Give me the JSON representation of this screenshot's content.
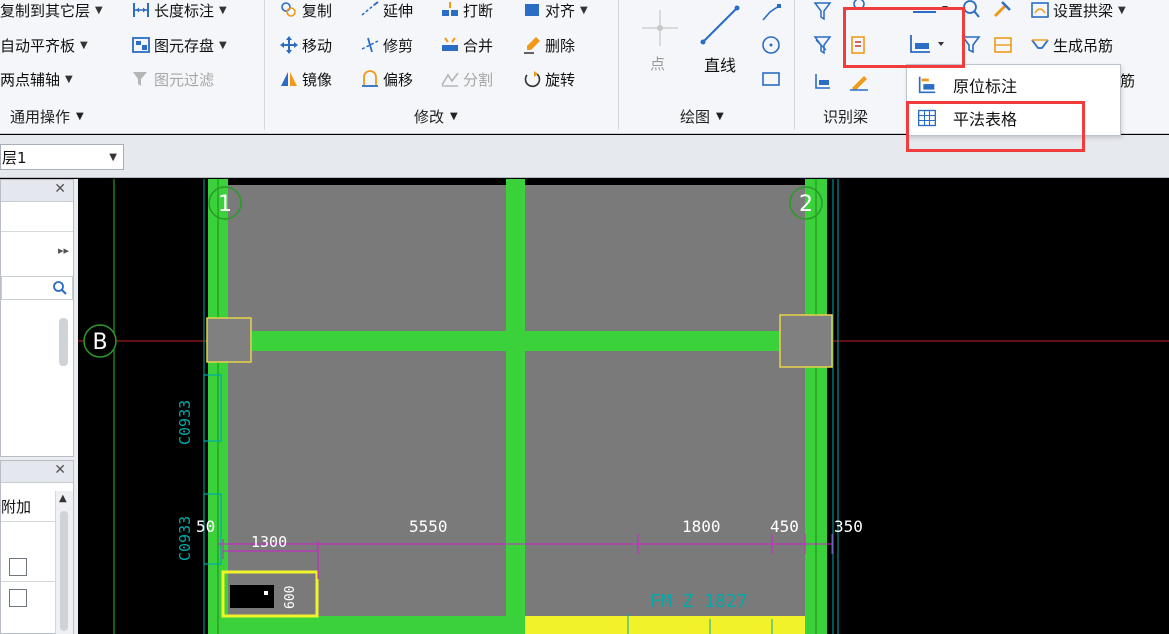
{
  "ribbon": {
    "general_ops": {
      "items": [
        {
          "label": "复制到其它层",
          "has_arrow": true
        },
        {
          "label": "自动平齐板",
          "has_arrow": true
        },
        {
          "label": "两点辅轴",
          "has_arrow": true
        }
      ],
      "items2": [
        {
          "label": "长度标注",
          "has_arrow": true,
          "disabled": false
        },
        {
          "label": "图元存盘",
          "has_arrow": true,
          "disabled": false
        },
        {
          "label": "图元过滤",
          "has_arrow": false,
          "disabled": true
        }
      ],
      "group_label": "通用操作"
    },
    "modify": {
      "items": [
        {
          "label": "复制",
          "icon": "copy-icon"
        },
        {
          "label": "延伸",
          "icon": "extend-icon"
        },
        {
          "label": "打断",
          "icon": "break-icon"
        },
        {
          "label": "对齐",
          "icon": "align-icon",
          "has_arrow": true
        },
        {
          "label": "移动",
          "icon": "move-icon"
        },
        {
          "label": "修剪",
          "icon": "trim-icon"
        },
        {
          "label": "合并",
          "icon": "merge-icon"
        },
        {
          "label": "删除",
          "icon": "delete-icon"
        },
        {
          "label": "镜像",
          "icon": "mirror-icon"
        },
        {
          "label": "偏移",
          "icon": "offset-icon"
        },
        {
          "label": "分割",
          "icon": "split-icon",
          "disabled": true
        },
        {
          "label": "旋转",
          "icon": "rotate-icon"
        }
      ],
      "group_label": "修改"
    },
    "draw": {
      "point_label": "点",
      "line_label": "直线",
      "group_label": "绘图"
    },
    "identify_beam": {
      "group_label": "识别梁"
    },
    "beam_ops": {
      "set_arch_beam": "设置拱梁",
      "generate_hanger": "生成吊筋",
      "partial_label": "筋"
    }
  },
  "dropdown": {
    "items": [
      {
        "label": "原位标注",
        "icon": "in-place-annotation-icon"
      },
      {
        "label": "平法表格",
        "icon": "table-grid-icon"
      }
    ]
  },
  "floor": {
    "selected": "层1"
  },
  "left_panel": {
    "column_header": "附加"
  },
  "canvas": {
    "axes": {
      "axis_1": "1",
      "axis_2": "2",
      "axis_b": "B"
    },
    "dimensions": [
      "50",
      "1300",
      "5550",
      "1800",
      "450",
      "350"
    ],
    "vertical_labels": [
      "C0933",
      "C0933"
    ],
    "small_labels": [
      "600",
      "FM Z 1827"
    ],
    "colors": {
      "member_green": "#3ad13a",
      "dimension_magenta": "#d21fd2",
      "label_cyan": "#00a9a9",
      "highlight_yellow": "#f2f22a",
      "grid_red": "#c82020",
      "slab_gray": "#7a7a7a"
    }
  }
}
